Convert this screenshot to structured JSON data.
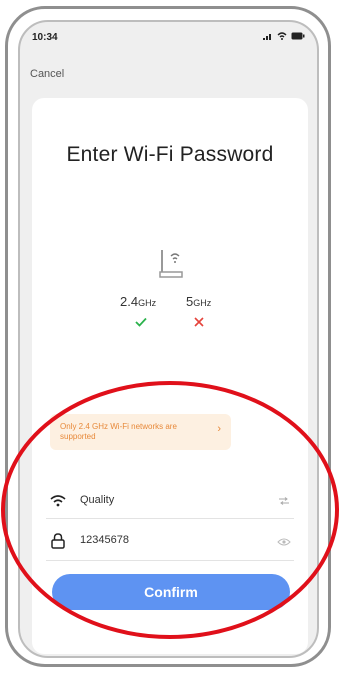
{
  "status_bar": {
    "time": "10:34"
  },
  "nav": {
    "cancel_label": "Cancel"
  },
  "page": {
    "title": "Enter Wi-Fi Password"
  },
  "bands": [
    {
      "value": "2.4",
      "unit": "GHz",
      "supported": true
    },
    {
      "value": "5",
      "unit": "GHz",
      "supported": false
    }
  ],
  "tip": {
    "text": "Only 2.4 GHz Wi-Fi networks are supported"
  },
  "wifi": {
    "network_name": "Quality",
    "password": "12345678"
  },
  "actions": {
    "confirm_label": "Confirm"
  },
  "colors": {
    "accent": "#5e93f2",
    "annotation": "#e0101a",
    "tip_text": "#e7893a",
    "success": "#2bb24c",
    "error": "#e5433b"
  }
}
